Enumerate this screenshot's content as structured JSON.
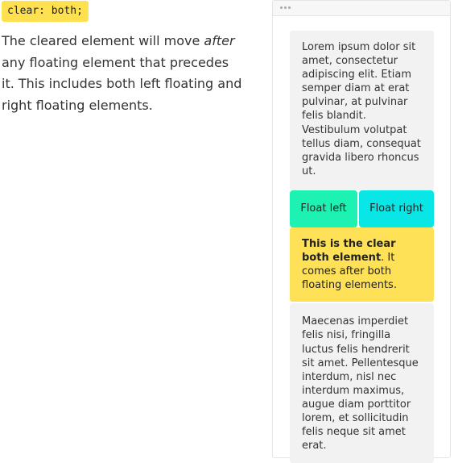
{
  "code_tag": "clear: both;",
  "explanation": {
    "before": "The cleared element will move ",
    "emphasis": "after",
    "after": " any floating element that precedes it. This includes both left floating and right floating elements."
  },
  "demo": {
    "paragraph_top": "Lorem ipsum dolor sit amet, consectetur adipiscing elit. Etiam semper diam at erat pulvinar, at pulvinar felis blandit. Vestibulum volutpat tellus diam, consequat gravida libero rhoncus ut.",
    "float_left_label": "Float left",
    "float_right_label": "Float right",
    "clear_bold": "This is the clear both element",
    "clear_rest": ". It comes after both floating elements.",
    "paragraph_bottom": "Maecenas imperdiet felis nisi, fringilla luctus felis hendrerit sit amet. Pellentesque interdum, nisl nec interdum maximus, augue diam porttitor lorem, et sollicitudin felis neque sit amet erat."
  },
  "colors": {
    "code_tag_bg": "#ffe04f",
    "float_left_bg": "#1df2b3",
    "float_right_bg": "#08e6e6",
    "clear_bg": "#ffe157",
    "text_block_bg": "#f2f2f2"
  }
}
